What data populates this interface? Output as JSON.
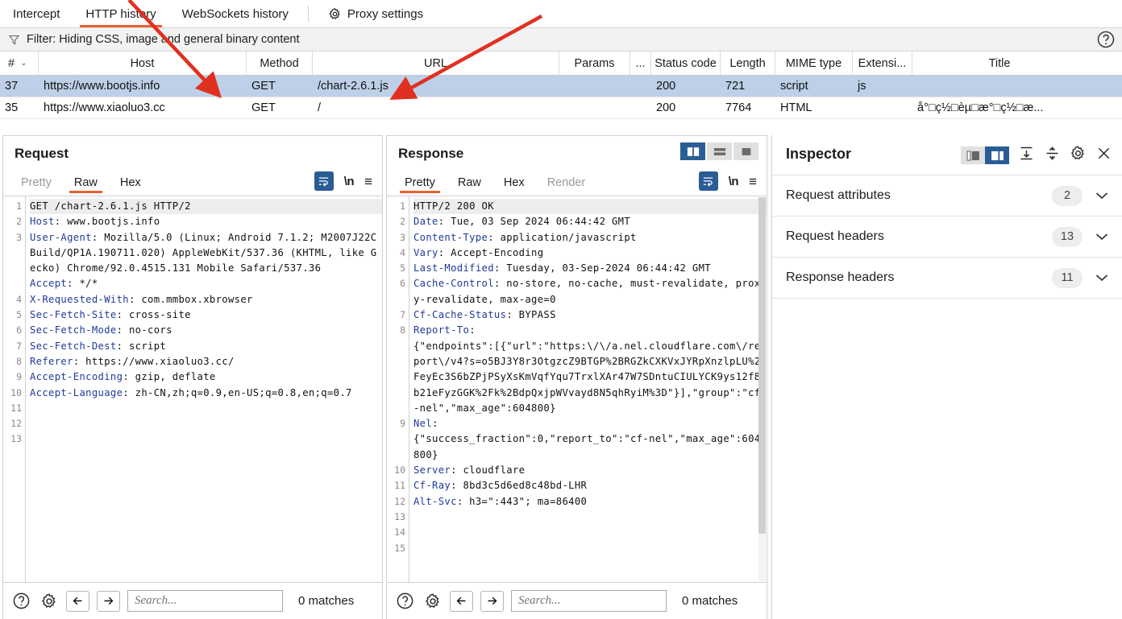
{
  "window": {
    "tabs": [
      {
        "label": "Intercept",
        "active": false
      },
      {
        "label": "HTTP history",
        "active": true
      },
      {
        "label": "WebSockets history",
        "active": false
      }
    ],
    "settings_tab": {
      "label": "Proxy settings",
      "icon": "gear-icon"
    }
  },
  "filter": {
    "icon": "funnel-icon",
    "text": "Filter: Hiding CSS, image and general binary content",
    "help_icon": "question-circle-icon"
  },
  "history_table": {
    "columns": [
      "#",
      "Host",
      "Method",
      "URL",
      "Params",
      "...",
      "Status code",
      "Length",
      "MIME type",
      "Extensi...",
      "Title"
    ],
    "sort_caret": "⌄",
    "rows": [
      {
        "num": "37",
        "host": "https://www.bootjs.info",
        "method": "GET",
        "url": "/chart-2.6.1.js",
        "params": "",
        "dots": "",
        "status": "200",
        "length": "721",
        "mime": "script",
        "ext": "js",
        "title": "",
        "selected": true
      },
      {
        "num": "35",
        "host": "https://www.xiaoluo3.cc",
        "method": "GET",
        "url": "/",
        "params": "",
        "dots": "",
        "status": "200",
        "length": "7764",
        "mime": "HTML",
        "ext": "",
        "title": "å°□ç½□èµ□æ°□ç½□æ...",
        "selected": false
      }
    ]
  },
  "request_panel": {
    "title": "Request",
    "tabs": [
      {
        "label": "Pretty",
        "state": "dim"
      },
      {
        "label": "Raw",
        "state": "active"
      },
      {
        "label": "Hex",
        "state": "normal"
      }
    ],
    "icons": {
      "wrap": "word-wrap-icon",
      "newline": "\\n",
      "menu": "≡"
    },
    "line_numbers": [
      "1",
      "2",
      "3",
      "",
      "",
      "",
      "4",
      "5",
      "6",
      "7",
      "8",
      "9",
      "10",
      "11",
      "12",
      "13"
    ],
    "lines": [
      {
        "key": "",
        "text": "GET /chart-2.6.1.js HTTP/2",
        "first": true
      },
      {
        "key": "Host",
        "text": ": www.bootjs.info"
      },
      {
        "key": "User-Agent",
        "text": ": Mozilla/5.0 (Linux; Android 7.1.2; M2007J22C Build/QP1A.190711.020) AppleWebKit/537.36 (KHTML, like Gecko) Chrome/92.0.4515.131 Mobile Safari/537.36"
      },
      {
        "key": "Accept",
        "text": ": */*"
      },
      {
        "key": "X-Requested-With",
        "text": ": com.mmbox.xbrowser"
      },
      {
        "key": "Sec-Fetch-Site",
        "text": ": cross-site"
      },
      {
        "key": "Sec-Fetch-Mode",
        "text": ": no-cors"
      },
      {
        "key": "Sec-Fetch-Dest",
        "text": ": script"
      },
      {
        "key": "Referer",
        "text": ": https://www.xiaoluo3.cc/"
      },
      {
        "key": "Accept-Encoding",
        "text": ": gzip, deflate"
      },
      {
        "key": "Accept-Language",
        "text": ": zh-CN,zh;q=0.9,en-US;q=0.8,en;q=0.7"
      }
    ],
    "search": {
      "placeholder": "Search...",
      "value": "",
      "matches": "0 matches",
      "help_icon": "question-circle-icon",
      "settings_icon": "gear-icon",
      "prev_icon": "arrow-left-icon",
      "next_icon": "arrow-right-icon"
    }
  },
  "response_panel": {
    "title": "Response",
    "tabs": [
      {
        "label": "Pretty",
        "state": "active"
      },
      {
        "label": "Raw",
        "state": "normal"
      },
      {
        "label": "Hex",
        "state": "normal"
      },
      {
        "label": "Render",
        "state": "dim"
      }
    ],
    "icons": {
      "wrap": "word-wrap-icon",
      "newline": "\\n",
      "menu": "≡"
    },
    "layout_toggle": [
      {
        "name": "side-by-side-layout-icon",
        "on": true
      },
      {
        "name": "stacked-layout-icon",
        "on": false
      },
      {
        "name": "single-pane-layout-icon",
        "on": false
      }
    ],
    "line_numbers": [
      "1",
      "2",
      "3",
      "4",
      "5",
      "6",
      "",
      "7",
      "8",
      "",
      "",
      "",
      "",
      "",
      "9",
      "",
      "",
      "10",
      "11",
      "12",
      "13",
      "14",
      "15"
    ],
    "lines": [
      {
        "key": "",
        "text": "HTTP/2 200 OK",
        "first": true
      },
      {
        "key": "Date",
        "text": ": Tue, 03 Sep 2024 06:44:42 GMT"
      },
      {
        "key": "Content-Type",
        "text": ": application/javascript"
      },
      {
        "key": "Vary",
        "text": ": Accept-Encoding"
      },
      {
        "key": "Last-Modified",
        "text": ": Tuesday, 03-Sep-2024 06:44:42 GMT"
      },
      {
        "key": "Cache-Control",
        "text": ": no-store, no-cache, must-revalidate, proxy-revalidate, max-age=0"
      },
      {
        "key": "Cf-Cache-Status",
        "text": ": BYPASS"
      },
      {
        "key": "Report-To",
        "text": ":"
      },
      {
        "key": "",
        "text": "{\"endpoints\":[{\"url\":\"https:\\/\\/a.nel.cloudflare.com\\/report\\/v4?s=o5BJ3Y8r3OtgzcZ9BTGP%2BRGZkCXKVxJYRpXnzlpLU%2FeyEc3S6bZPjPSyXsKmVqfYqu7TrxlXAr47W7SDntuCIULYCK9ys12f8b21eFyzGGK%2Fk%2BdpQxjpWVvayd8N5qhRyiM%3D\"}],\"group\":\"cf-nel\",\"max_age\":604800}"
      },
      {
        "key": "Nel",
        "text": ":"
      },
      {
        "key": "",
        "text": "{\"success_fraction\":0,\"report_to\":\"cf-nel\",\"max_age\":604800}"
      },
      {
        "key": "Server",
        "text": ": cloudflare"
      },
      {
        "key": "Cf-Ray",
        "text": ": 8bd3c5d6ed8c48bd-LHR"
      },
      {
        "key": "Alt-Svc",
        "text": ": h3=\":443\"; ma=86400"
      }
    ],
    "search": {
      "placeholder": "Search...",
      "value": "",
      "matches": "0 matches",
      "help_icon": "question-circle-icon",
      "settings_icon": "gear-icon",
      "prev_icon": "arrow-left-icon",
      "next_icon": "arrow-right-icon"
    }
  },
  "inspector": {
    "title": "Inspector",
    "layout_toggle": [
      {
        "name": "inspector-left-layout-icon",
        "on": false
      },
      {
        "name": "inspector-right-layout-icon",
        "on": true
      }
    ],
    "icons": {
      "expand_all": "expand-all-icon",
      "collapse_all": "collapse-all-icon",
      "settings": "gear-icon",
      "close": "close-icon"
    },
    "sections": [
      {
        "label": "Request attributes",
        "count": "2",
        "chevron": "⌄"
      },
      {
        "label": "Request headers",
        "count": "13",
        "chevron": "⌄"
      },
      {
        "label": "Response headers",
        "count": "11",
        "chevron": "⌄"
      }
    ]
  },
  "colors": {
    "accent_orange": "#e8622c",
    "selection_blue": "#bdd0e8",
    "toggle_blue": "#2a5c96",
    "annotation_red": "#e03020",
    "header_key_blue": "#1f3b99"
  }
}
